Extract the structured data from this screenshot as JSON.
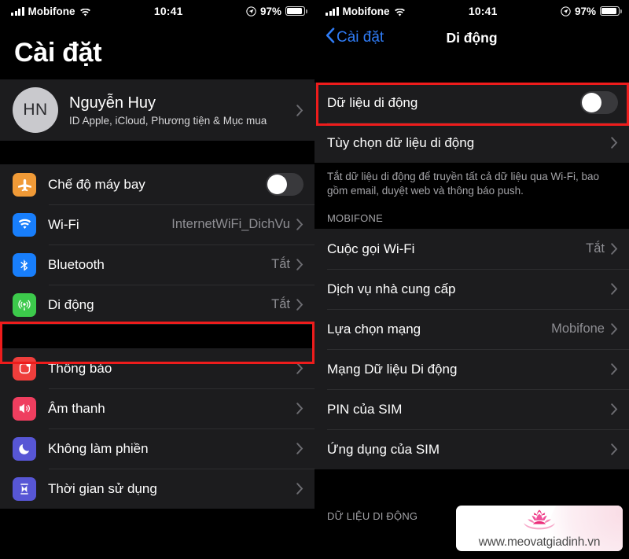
{
  "status_bar": {
    "carrier": "Mobifone",
    "time": "10:41",
    "battery_percent": "97%",
    "signal_icon": "signal-bars-icon",
    "wifi_icon": "wifi-icon",
    "location_icon": "location-arrow-icon",
    "battery_icon": "battery-icon"
  },
  "colors": {
    "accent_blue": "#2f7cf6",
    "highlight_red": "#ee1c1c",
    "row_bg": "#1c1c1e",
    "page_bg": "#000000",
    "value_gray": "#8e8e93",
    "airplane_orange": "#f09a37",
    "wifi_blue": "#187efb",
    "bluetooth_blue": "#187efb",
    "cellular_green": "#3cc94b",
    "notifications_red": "#ef3e3c",
    "sounds_pink": "#ef3e5f",
    "dnd_purple": "#5756d5",
    "screentime_purple": "#5756d5"
  },
  "left_screen": {
    "title": "Cài đặt",
    "account": {
      "initials": "HN",
      "name": "Nguyễn Huy",
      "subtitle": "ID Apple, iCloud, Phương tiện & Mục mua",
      "chevron": "chevron-right-icon"
    },
    "group_one": [
      {
        "label": "Chế độ máy bay",
        "icon": "airplane-icon",
        "control": "toggle",
        "toggle_on": false
      },
      {
        "label": "Wi-Fi",
        "icon": "wifi-icon",
        "value": "InternetWiFi_DichVu",
        "control": "chevron"
      },
      {
        "label": "Bluetooth",
        "icon": "bluetooth-icon",
        "value": "Tắt",
        "control": "chevron"
      },
      {
        "label": "Di động",
        "icon": "cellular-icon",
        "value": "Tắt",
        "control": "chevron",
        "highlighted": true
      }
    ],
    "group_two": [
      {
        "label": "Thông báo",
        "icon": "notifications-icon",
        "control": "chevron"
      },
      {
        "label": "Âm thanh",
        "icon": "sounds-icon",
        "control": "chevron"
      },
      {
        "label": "Không làm phiền",
        "icon": "moon-icon",
        "control": "chevron"
      },
      {
        "label": "Thời gian sử dụng",
        "icon": "hourglass-icon",
        "control": "chevron"
      }
    ]
  },
  "right_screen": {
    "back_label": "Cài đặt",
    "back_icon": "chevron-left-icon",
    "title": "Di động",
    "data_group": [
      {
        "label": "Dữ liệu di động",
        "control": "toggle",
        "toggle_on": false,
        "highlighted": true
      },
      {
        "label": "Tùy chọn dữ liệu di động",
        "control": "chevron"
      }
    ],
    "footnote": "Tắt dữ liệu di động để truyền tất cả dữ liệu qua Wi-Fi, bao gồm email, duyệt web và thông báo push.",
    "section_header": "MOBIFONE",
    "carrier_group": [
      {
        "label": "Cuộc gọi Wi-Fi",
        "value": "Tắt",
        "control": "chevron"
      },
      {
        "label": "Dịch vụ nhà cung cấp",
        "control": "chevron"
      },
      {
        "label": "Lựa chọn mạng",
        "value": "Mobifone",
        "control": "chevron"
      },
      {
        "label": "Mạng Dữ liệu Di động",
        "control": "chevron"
      },
      {
        "label": "PIN của SIM",
        "control": "chevron"
      },
      {
        "label": "Ứng dụng của SIM",
        "control": "chevron"
      }
    ],
    "bottom_section_header": "DỮ LIỆU DI ĐỘNG"
  },
  "watermark": {
    "text": "www.meovatgiadinh.vn",
    "logo": "lotus-flower-icon"
  }
}
